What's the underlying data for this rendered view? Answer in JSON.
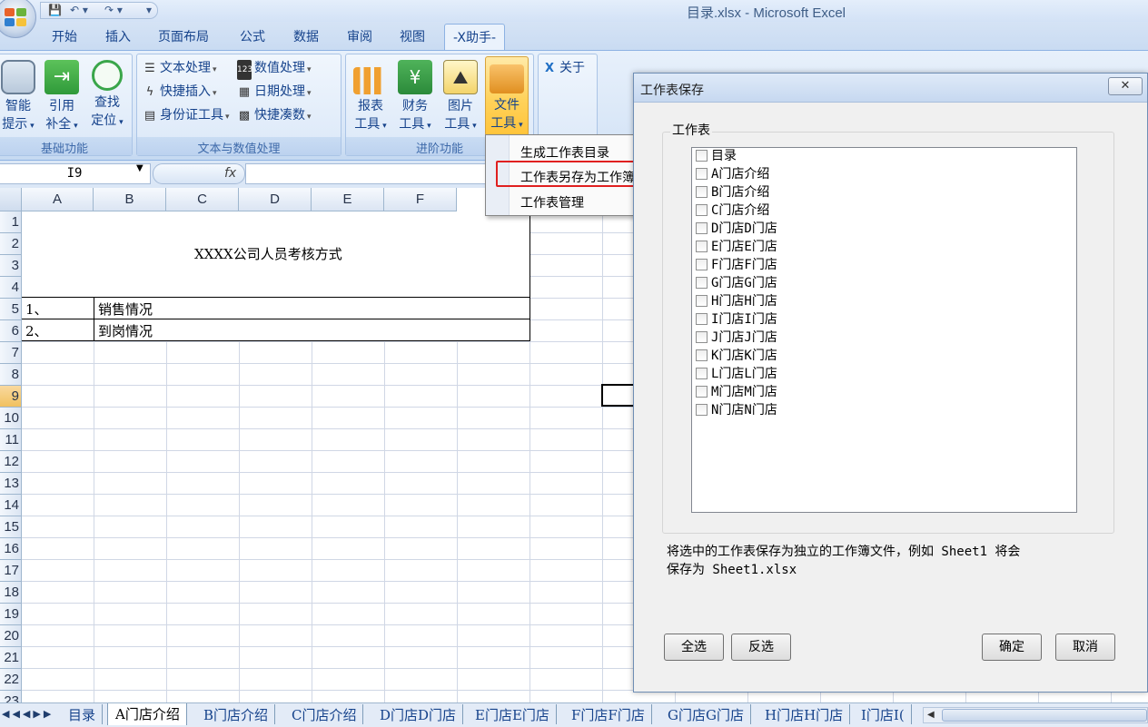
{
  "window": {
    "title": "目录.xlsx - Microsoft Excel"
  },
  "qat": {
    "save_icon": "save-icon",
    "undo_icon": "undo-icon",
    "redo_icon": "redo-icon"
  },
  "tabs": [
    "开始",
    "插入",
    "页面布局",
    "公式",
    "数据",
    "审阅",
    "视图",
    "-X助手-"
  ],
  "ribbon": {
    "basic": {
      "label": "基础功能",
      "buttons": [
        {
          "l1": "智能",
          "l2": "提示"
        },
        {
          "l1": "引用",
          "l2": "补全"
        },
        {
          "l1": "查找",
          "l2": "定位"
        }
      ]
    },
    "text": {
      "label": "文本与数值处理",
      "buttons": [
        "文本处理",
        "快捷插入",
        "身份证工具",
        "数值处理",
        "日期处理",
        "快捷凑数"
      ]
    },
    "advanced": {
      "label": "进阶功能",
      "buttons": [
        {
          "l1": "报表",
          "l2": "工具"
        },
        {
          "l1": "财务",
          "l2": "工具"
        },
        {
          "l1": "图片",
          "l2": "工具"
        },
        {
          "l1": "文件",
          "l2": "工具"
        }
      ]
    },
    "about": "关于"
  },
  "formula": {
    "namebox": "I9",
    "fx": "fx",
    "value": ""
  },
  "grid": {
    "columns": [
      "A",
      "B",
      "C",
      "D",
      "E",
      "F"
    ],
    "rows": [
      "1",
      "2",
      "3",
      "4",
      "5",
      "6",
      "7",
      "8",
      "9",
      "10",
      "11",
      "12",
      "13",
      "14",
      "15",
      "16",
      "17",
      "18",
      "19",
      "20",
      "21",
      "22",
      "23"
    ],
    "selected_row": "9",
    "title": "XXXX公司人员考核方式",
    "items": [
      {
        "num": "1、",
        "text": "销售情况"
      },
      {
        "num": "2、",
        "text": "到岗情况"
      }
    ]
  },
  "menu": {
    "items": [
      "生成工作表目录",
      "工作表另存为工作簿",
      "工作表管理"
    ],
    "highlighted": "工作表另存为工作簿"
  },
  "sheet_tabs": [
    "目录",
    "A门店介绍",
    "B门店介绍",
    "C门店介绍",
    "D门店D门店",
    "E门店E门店",
    "F门店F门店",
    "G门店G门店",
    "H门店H门店",
    "I门店I("
  ],
  "active_sheet": "A门店介绍",
  "dialog": {
    "title": "工作表保存",
    "close": "✕",
    "group_label": "工作表",
    "list": [
      "目录",
      "A门店介绍",
      "B门店介绍",
      "C门店介绍",
      "D门店D门店",
      "E门店E门店",
      "F门店F门店",
      "G门店G门店",
      "H门店H门店",
      "I门店I门店",
      "J门店J门店",
      "K门店K门店",
      "L门店L门店",
      "M门店M门店",
      "N门店N门店"
    ],
    "description_line1": "将选中的工作表保存为独立的工作簿文件，例如 Sheet1 将会",
    "description_line2": "保存为 Sheet1.xlsx",
    "select_all": "全选",
    "invert": "反选",
    "ok": "确定",
    "cancel": "取消"
  }
}
